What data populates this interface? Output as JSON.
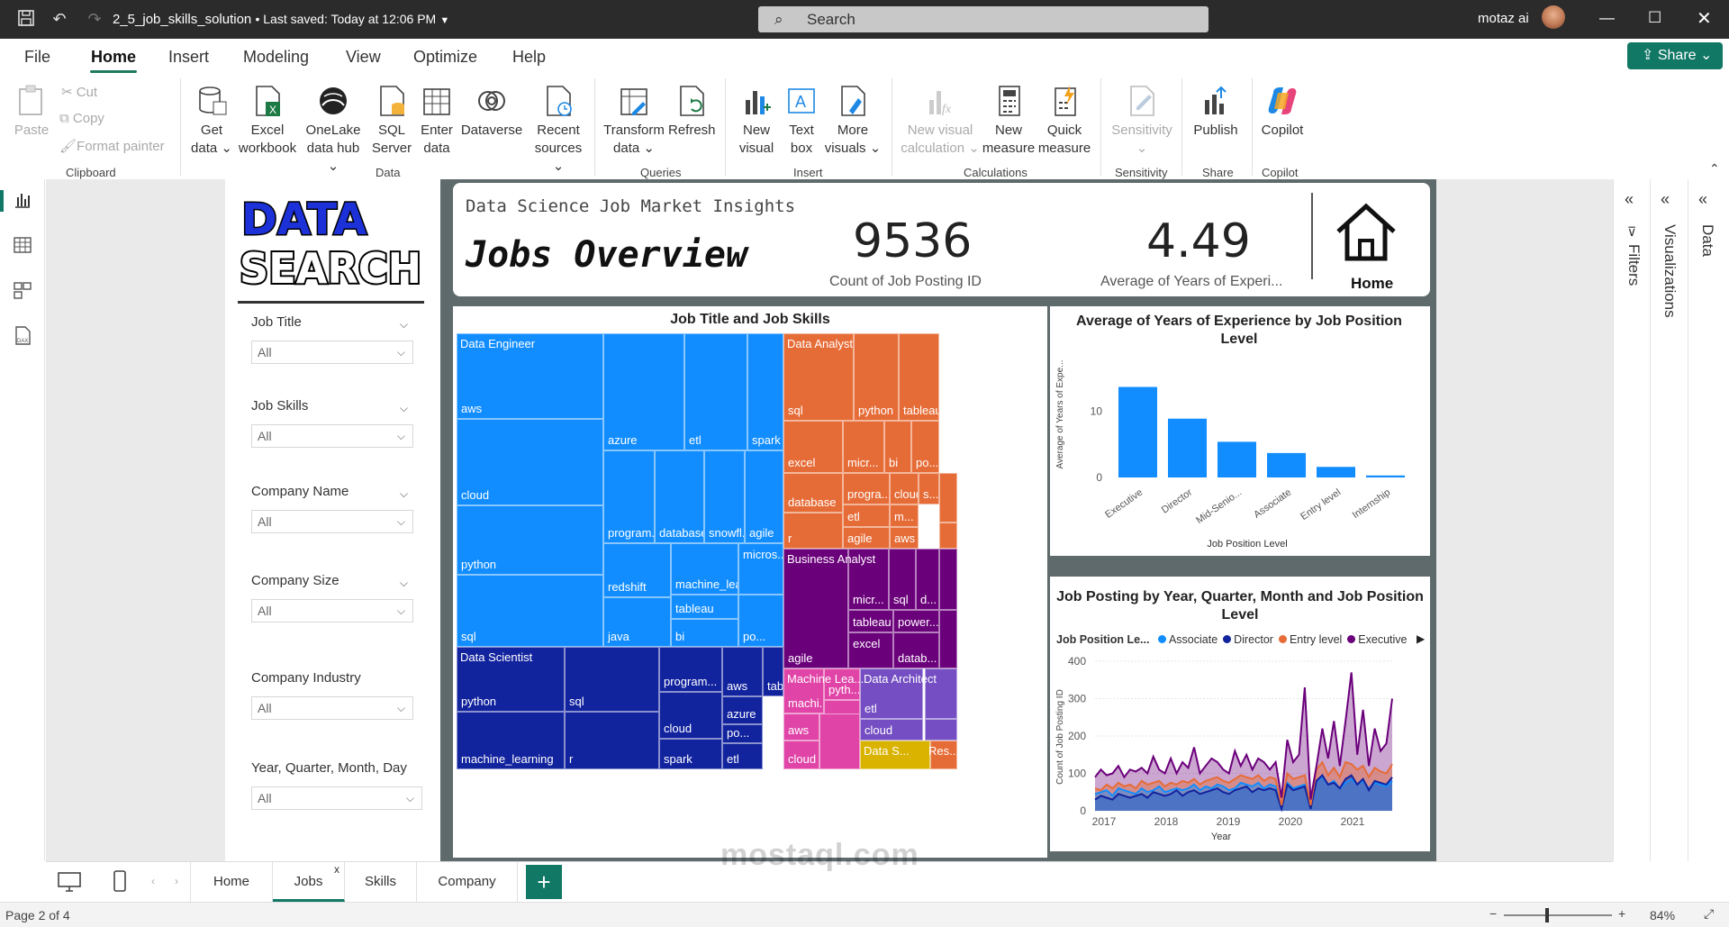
{
  "titlebar": {
    "file_name": "2_5_job_skills_solution",
    "saved": "• Last saved: Today at 12:06 PM",
    "search_placeholder": "Search",
    "user_name": "motaz ai"
  },
  "menu": {
    "items": [
      "File",
      "Home",
      "Insert",
      "Modeling",
      "View",
      "Optimize",
      "Help"
    ],
    "active": "Home",
    "share_label": "Share"
  },
  "ribbon": {
    "clipboard": {
      "paste": "Paste",
      "cut": "Cut",
      "copy": "Copy",
      "format_painter": "Format painter",
      "group": "Clipboard"
    },
    "data": {
      "items": [
        {
          "l1": "Get",
          "l2": "data ⌄"
        },
        {
          "l1": "Excel",
          "l2": "workbook"
        },
        {
          "l1": "OneLake",
          "l2": "data hub ⌄"
        },
        {
          "l1": "SQL",
          "l2": "Server"
        },
        {
          "l1": "Enter",
          "l2": "data"
        },
        {
          "l1": "Dataverse",
          "l2": ""
        },
        {
          "l1": "Recent",
          "l2": "sources ⌄"
        }
      ],
      "group": "Data"
    },
    "queries": {
      "items": [
        {
          "l1": "Transform",
          "l2": "data ⌄"
        },
        {
          "l1": "Refresh",
          "l2": ""
        }
      ],
      "group": "Queries"
    },
    "insert": {
      "items": [
        {
          "l1": "New",
          "l2": "visual"
        },
        {
          "l1": "Text",
          "l2": "box"
        },
        {
          "l1": "More",
          "l2": "visuals ⌄"
        }
      ],
      "group": "Insert"
    },
    "calculations": {
      "items": [
        {
          "l1": "New visual",
          "l2": "calculation ⌄"
        },
        {
          "l1": "New",
          "l2": "measure"
        },
        {
          "l1": "Quick",
          "l2": "measure"
        }
      ],
      "group": "Calculations"
    },
    "sensitivity": {
      "l1": "Sensitivity",
      "l2": "⌄",
      "group": "Sensitivity"
    },
    "share": {
      "l1": "Publish",
      "group": "Share"
    },
    "copilot": {
      "l1": "Copilot",
      "group": "Copilot"
    }
  },
  "slicers": [
    {
      "title": "Job Title",
      "value": "All"
    },
    {
      "title": "Job Skills",
      "value": "All"
    },
    {
      "title": "Company Name",
      "value": "All"
    },
    {
      "title": "Company Size",
      "value": "All"
    },
    {
      "title": "Company Industry",
      "value": "All"
    },
    {
      "title": "Year, Quarter, Month, Day",
      "value": "All"
    }
  ],
  "logo": {
    "line1": "DATA",
    "line2": "SEARCH"
  },
  "header": {
    "subtitle": "Data Science Job Market Insights",
    "title": "Jobs Overview",
    "kpi1_value": "9536",
    "kpi1_label": "Count of Job Posting ID",
    "kpi2_value": "4.49",
    "kpi2_label": "Average of Years of Experi...",
    "home_label": "Home"
  },
  "treemap": {
    "title": "Job Title and Job Skills",
    "colors": {
      "Data Engineer": "#118dff",
      "Data Analyst": "#e66c37",
      "Business Analyst": "#6b007b",
      "Data Scientist": "#12239e",
      "Machine Learning": "#e044a7",
      "Data Architect": "#744ec2",
      "Data Sci": "#d9b300"
    },
    "tiles": [
      {
        "group": "Data Engineer",
        "skill": "aws",
        "label_group": "Data Engineer"
      },
      {
        "group": "Data Engineer",
        "skill": "cloud"
      },
      {
        "group": "Data Engineer",
        "skill": "python"
      },
      {
        "group": "Data Engineer",
        "skill": "sql"
      },
      {
        "group": "Data Engineer",
        "skill": "azure"
      },
      {
        "group": "Data Engineer",
        "skill": "etl"
      },
      {
        "group": "Data Engineer",
        "skill": "spark"
      },
      {
        "group": "Data Engineer",
        "skill": "program..."
      },
      {
        "group": "Data Engineer",
        "skill": "database"
      },
      {
        "group": "Data Engineer",
        "skill": "snowfl..."
      },
      {
        "group": "Data Engineer",
        "skill": "agile"
      },
      {
        "group": "Data Engineer",
        "skill": "redshift"
      },
      {
        "group": "Data Engineer",
        "skill": "machine_lear..."
      },
      {
        "group": "Data Engineer",
        "skill": "micros..."
      },
      {
        "group": "Data Engineer",
        "skill": "tableau"
      },
      {
        "group": "Data Engineer",
        "skill": "java"
      },
      {
        "group": "Data Engineer",
        "skill": "bi"
      },
      {
        "group": "Data Engineer",
        "skill": "po..."
      },
      {
        "group": "Data Analyst",
        "skill": "sql"
      },
      {
        "group": "Data Analyst",
        "skill": "python"
      },
      {
        "group": "Data Analyst",
        "skill": "tableau"
      },
      {
        "group": "Data Analyst",
        "skill": "excel"
      },
      {
        "group": "Data Analyst",
        "skill": "micr..."
      },
      {
        "group": "Data Analyst",
        "skill": "bi"
      },
      {
        "group": "Data Analyst",
        "skill": "po..."
      },
      {
        "group": "Data Analyst",
        "skill": "database"
      },
      {
        "group": "Data Analyst",
        "skill": "progra..."
      },
      {
        "group": "Data Analyst",
        "skill": "cloud"
      },
      {
        "group": "Data Analyst",
        "skill": "s..."
      },
      {
        "group": "Data Analyst",
        "skill": "etl"
      },
      {
        "group": "Data Analyst",
        "skill": "m..."
      },
      {
        "group": "Data Analyst",
        "skill": "r"
      },
      {
        "group": "Data Analyst",
        "skill": "agile"
      },
      {
        "group": "Data Analyst",
        "skill": "aws"
      },
      {
        "group": "Business Analyst",
        "skill": "agile"
      },
      {
        "group": "Business Analyst",
        "skill": "micr..."
      },
      {
        "group": "Business Analyst",
        "skill": "sql"
      },
      {
        "group": "Business Analyst",
        "skill": "d..."
      },
      {
        "group": "Business Analyst",
        "skill": "tableau"
      },
      {
        "group": "Business Analyst",
        "skill": "power..."
      },
      {
        "group": "Business Analyst",
        "skill": "excel"
      },
      {
        "group": "Business Analyst",
        "skill": "datab..."
      },
      {
        "group": "Data Scientist",
        "skill": "python"
      },
      {
        "group": "Data Scientist",
        "skill": "machine_learning"
      },
      {
        "group": "Data Scientist",
        "skill": "sql"
      },
      {
        "group": "Data Scientist",
        "skill": "r"
      },
      {
        "group": "Data Scientist",
        "skill": "program..."
      },
      {
        "group": "Data Scientist",
        "skill": "aws"
      },
      {
        "group": "Data Scientist",
        "skill": "tabl..."
      },
      {
        "group": "Data Scientist",
        "skill": "cloud"
      },
      {
        "group": "Data Scientist",
        "skill": "azure"
      },
      {
        "group": "Data Scientist",
        "skill": "po..."
      },
      {
        "group": "Data Scientist",
        "skill": "spark"
      },
      {
        "group": "Data Scientist",
        "skill": "etl"
      },
      {
        "group": "Machine Learning",
        "skill": "machi..."
      },
      {
        "group": "Machine Learning",
        "skill": "pyth..."
      },
      {
        "group": "Machine Learning",
        "skill": "aws"
      },
      {
        "group": "Machine Learning",
        "skill": "cloud"
      },
      {
        "group": "Data Architect",
        "skill": "etl"
      },
      {
        "group": "Data Architect",
        "skill": "cloud"
      }
    ],
    "group_labels": [
      "Data Engineer",
      "Data Analyst",
      "Business Analyst",
      "Data Scientist",
      "Machine Lea...",
      "Data Architect",
      "Data S...",
      "Res..."
    ]
  },
  "chart_data": [
    {
      "type": "bar",
      "title": "Average of Years of Experience by Job Position Level",
      "xlabel": "Job Position Level",
      "ylabel": "Average of Years of Expe...",
      "categories": [
        "Executive",
        "Director",
        "Mid-Senio...",
        "Associate",
        "Entry level",
        "Internship"
      ],
      "values": [
        13.7,
        8.9,
        5.4,
        3.7,
        1.6,
        0.3
      ],
      "ylim": [
        0,
        15
      ],
      "yticks": [
        "0",
        "10"
      ],
      "color": "#118dff"
    },
    {
      "type": "line",
      "title": "Job Posting by Year, Quarter, Month and Job Position Level",
      "xlabel": "Year",
      "ylabel": "Count of Job Posting ID",
      "legend_title": "Job Position Le...",
      "legend_position": "top",
      "ylim": [
        0,
        400
      ],
      "yticks": [
        "0",
        "100",
        "200",
        "300",
        "400"
      ],
      "xticks": [
        "2017",
        "2018",
        "2019",
        "2020",
        "2021"
      ],
      "series": [
        {
          "name": "Associate",
          "color": "#118dff",
          "values": [
            45,
            50,
            55,
            40,
            60,
            55,
            50,
            45,
            60,
            50,
            55,
            65,
            50,
            55,
            60,
            55,
            60,
            70,
            55,
            65,
            60,
            70,
            65,
            55,
            60,
            75,
            70,
            65,
            75,
            60,
            70,
            65,
            10,
            75,
            60,
            65,
            70,
            10,
            80,
            90,
            70,
            80,
            60,
            75,
            85,
            70,
            80,
            60,
            75,
            70,
            65,
            80
          ]
        },
        {
          "name": "Director",
          "color": "#12239e",
          "values": [
            30,
            40,
            35,
            30,
            45,
            40,
            35,
            40,
            45,
            35,
            50,
            45,
            40,
            45,
            55,
            40,
            50,
            55,
            45,
            50,
            55,
            60,
            50,
            45,
            55,
            60,
            65,
            50,
            60,
            55,
            60,
            55,
            5,
            70,
            55,
            60,
            65,
            5,
            80,
            95,
            70,
            75,
            60,
            85,
            95,
            70,
            85,
            55,
            80,
            75,
            70,
            90
          ]
        },
        {
          "name": "Entry level",
          "color": "#e66c37",
          "values": [
            60,
            55,
            70,
            60,
            75,
            65,
            70,
            60,
            80,
            70,
            75,
            80,
            65,
            75,
            70,
            80,
            75,
            85,
            70,
            80,
            85,
            90,
            80,
            75,
            85,
            95,
            90,
            85,
            95,
            80,
            90,
            85,
            15,
            100,
            85,
            90,
            95,
            15,
            110,
            130,
            95,
            115,
            90,
            130,
            125,
            110,
            120,
            90,
            115,
            105,
            100,
            125
          ]
        },
        {
          "name": "Executive",
          "color": "#6b007b",
          "values": [
            90,
            110,
            95,
            100,
            120,
            90,
            110,
            105,
            115,
            100,
            145,
            110,
            100,
            140,
            100,
            130,
            115,
            170,
            100,
            120,
            140,
            130,
            110,
            100,
            160,
            120,
            150,
            110,
            140,
            130,
            110,
            130,
            35,
            190,
            130,
            150,
            330,
            30,
            120,
            220,
            140,
            240,
            120,
            240,
            370,
            150,
            270,
            120,
            220,
            160,
            180,
            300
          ]
        }
      ]
    }
  ],
  "tabs": {
    "items": [
      "Home",
      "Jobs",
      "Skills",
      "Company"
    ],
    "active": "Jobs",
    "close": "x"
  },
  "status": {
    "page": "Page 2 of 4",
    "zoom": "84%"
  },
  "rightpane": {
    "filters": "Filters",
    "visualizations": "Visualizations",
    "data": "Data"
  },
  "watermark": "mostaql.com"
}
